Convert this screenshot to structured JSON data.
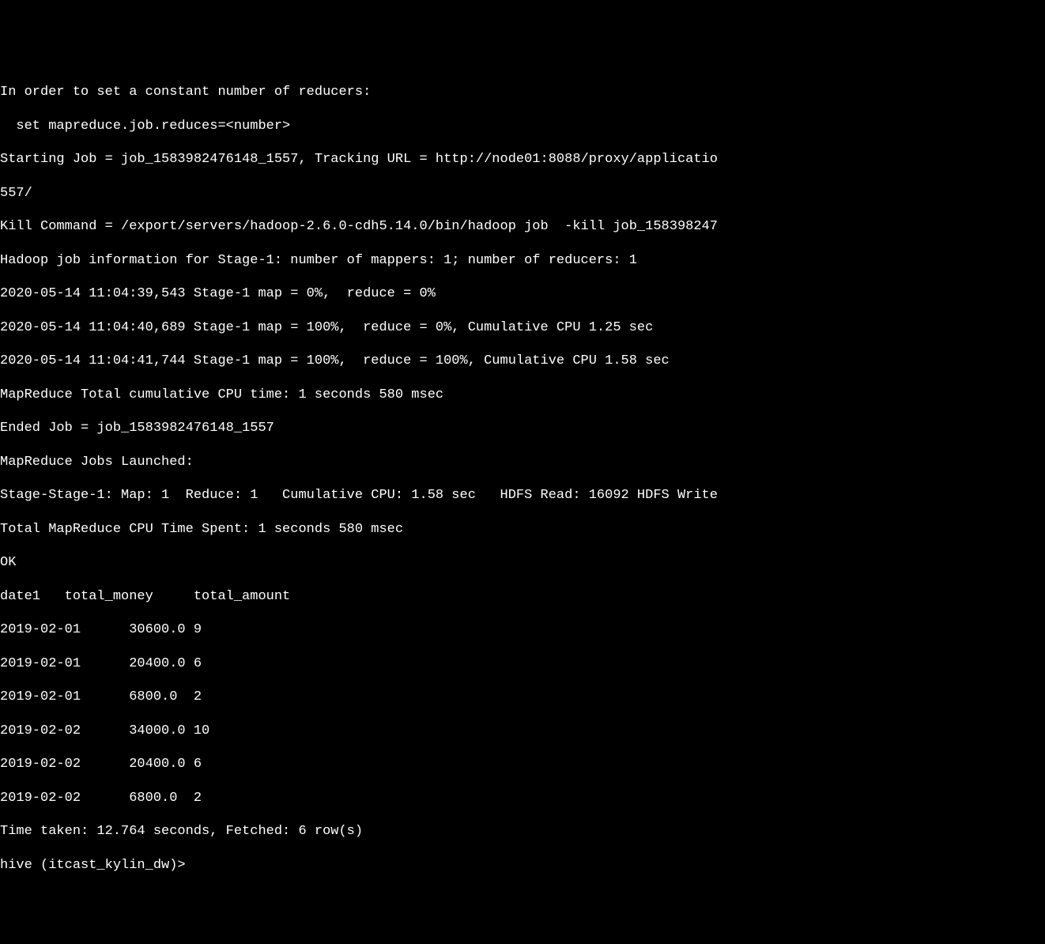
{
  "terminal": {
    "lines": [
      "In order to set a constant number of reducers:",
      "  set mapreduce.job.reduces=<number>",
      "Starting Job = job_1583982476148_1557, Tracking URL = http://node01:8088/proxy/applicatio",
      "557/",
      "Kill Command = /export/servers/hadoop-2.6.0-cdh5.14.0/bin/hadoop job  -kill job_158398247",
      "Hadoop job information for Stage-1: number of mappers: 1; number of reducers: 1",
      "2020-05-14 11:04:39,543 Stage-1 map = 0%,  reduce = 0%",
      "2020-05-14 11:04:40,689 Stage-1 map = 100%,  reduce = 0%, Cumulative CPU 1.25 sec",
      "2020-05-14 11:04:41,744 Stage-1 map = 100%,  reduce = 100%, Cumulative CPU 1.58 sec",
      "MapReduce Total cumulative CPU time: 1 seconds 580 msec",
      "Ended Job = job_1583982476148_1557",
      "MapReduce Jobs Launched:",
      "Stage-Stage-1: Map: 1  Reduce: 1   Cumulative CPU: 1.58 sec   HDFS Read: 16092 HDFS Write",
      "Total MapReduce CPU Time Spent: 1 seconds 580 msec",
      "OK",
      "date1   total_money     total_amount",
      "2019-02-01      30600.0 9",
      "2019-02-01      20400.0 6",
      "2019-02-01      6800.0  2",
      "2019-02-02      34000.0 10",
      "2019-02-02      20400.0 6",
      "2019-02-02      6800.0  2",
      "Time taken: 12.764 seconds, Fetched: 6 row(s)",
      "hive (itcast_kylin_dw)>"
    ]
  },
  "result_table": {
    "headers": [
      "date1",
      "total_money",
      "total_amount"
    ],
    "rows": [
      {
        "date1": "2019-02-01",
        "total_money": "30600.0",
        "total_amount": "9"
      },
      {
        "date1": "2019-02-01",
        "total_money": "20400.0",
        "total_amount": "6"
      },
      {
        "date1": "2019-02-01",
        "total_money": "6800.0",
        "total_amount": "2"
      },
      {
        "date1": "2019-02-02",
        "total_money": "34000.0",
        "total_amount": "10"
      },
      {
        "date1": "2019-02-02",
        "total_money": "20400.0",
        "total_amount": "6"
      },
      {
        "date1": "2019-02-02",
        "total_money": "6800.0",
        "total_amount": "2"
      }
    ]
  },
  "job_info": {
    "job_id": "job_1583982476148_1557",
    "tracking_url": "http://node01:8088/proxy/applicatio",
    "kill_command": "/export/servers/hadoop-2.6.0-cdh5.14.0/bin/hadoop job  -kill job_158398247",
    "mappers": 1,
    "reducers": 1,
    "cumulative_cpu": "1.58 sec",
    "hdfs_read": 16092,
    "time_taken": "12.764 seconds",
    "rows_fetched": 6
  },
  "prompt": "hive (itcast_kylin_dw)>"
}
